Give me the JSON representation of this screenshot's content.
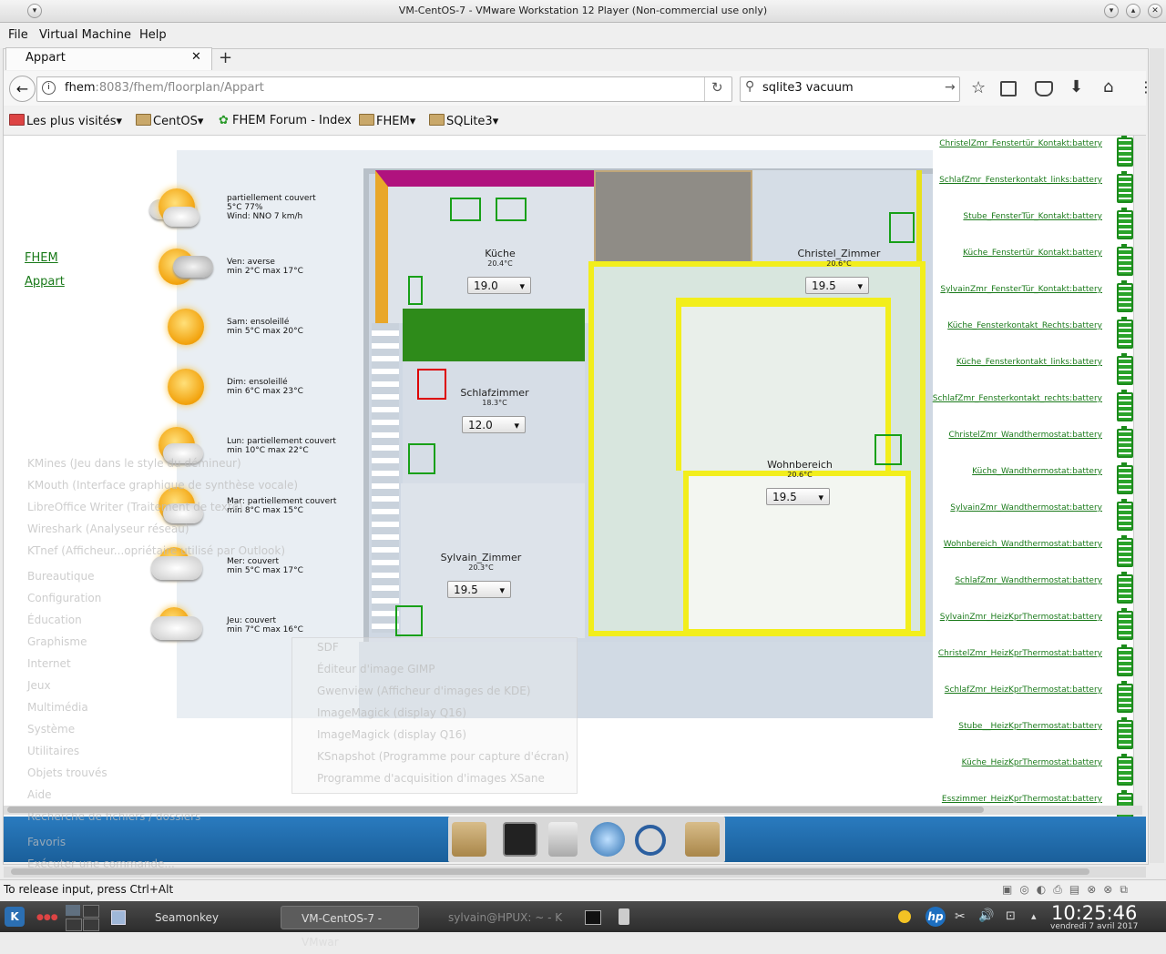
{
  "window": {
    "title": "VM-CentOS-7 - VMware Workstation 12 Player (Non-commercial use only)",
    "menu": [
      "File",
      "Virtual Machine",
      "Help"
    ]
  },
  "browser": {
    "tab_title": "Appart",
    "url_host": "fhem",
    "url_path": ":8083/fhem/floorplan/Appart",
    "search_value": "sqlite3 vacuum",
    "bookmarks": [
      "Les plus visités",
      "CentOS",
      "FHEM Forum - Index",
      "FHEM",
      "SQLite3"
    ]
  },
  "fhem": {
    "links": [
      "FHEM",
      "Appart"
    ],
    "weather": [
      {
        "line1": "partiellement couvert",
        "line2": "5°C 77%",
        "line3": "Wind: NNO 7 km/h",
        "icon": "partly-cloudy-icon"
      },
      {
        "line1": "Ven: averse",
        "line2": "min 2°C max 17°C",
        "icon": "rain-showers-icon"
      },
      {
        "line1": "Sam: ensoleillé",
        "line2": "min 5°C max 20°C",
        "icon": "sunny-icon"
      },
      {
        "line1": "Dim: ensoleillé",
        "line2": "min 6°C max 23°C",
        "icon": "sunny-icon"
      },
      {
        "line1": "Lun: partiellement couvert",
        "line2": "min 10°C max 22°C",
        "icon": "partly-cloudy-icon"
      },
      {
        "line1": "Mar: partiellement couvert",
        "line2": "min 8°C max 15°C",
        "icon": "partly-cloudy-icon"
      },
      {
        "line1": "Mer: couvert",
        "line2": "min 5°C max 17°C",
        "icon": "cloudy-icon"
      },
      {
        "line1": "Jeu: couvert",
        "line2": "min 7°C max 16°C",
        "icon": "cloudy-icon"
      }
    ],
    "rooms": [
      {
        "name": "Küche",
        "temp": "20.4°C",
        "setpoint": "19.0"
      },
      {
        "name": "Christel_Zimmer",
        "temp": "20.6°C",
        "setpoint": "19.5"
      },
      {
        "name": "Schlafzimmer",
        "temp": "18.3°C",
        "setpoint": "12.0"
      },
      {
        "name": "Wohnbereich",
        "temp": "20.6°C",
        "setpoint": "19.5"
      },
      {
        "name": "Sylvain_Zimmer",
        "temp": "20.3°C",
        "setpoint": "19.5"
      }
    ],
    "battery_links": [
      "ChristelZmr_Fenstertür_Kontakt:battery",
      "SchlafZmr_Fensterkontakt_links:battery",
      "Stube_FensterTür_Kontakt:battery",
      "Küche_Fenstertür_Kontakt:battery",
      "SylvainZmr_FensterTür_Kontakt:battery",
      "Küche_Fensterkontakt_Rechts:battery",
      "Küche_Fensterkontakt_links:battery",
      "SchlafZmr_Fensterkontakt_rechts:battery",
      "ChristelZmr_Wandthermostat:battery",
      "Küche_Wandthermostat:battery",
      "SylvainZmr_Wandthermostat:battery",
      "Wohnbereich_Wandthermostat:battery",
      "SchlafZmr_Wandthermostat:battery",
      "SylvainZmr_HeizKprThermostat:battery",
      "ChristelZmr_HeizKprThermostat:battery",
      "SchlafZmr_HeizKprThermostat:battery",
      "Stube__HeizKprThermostat:battery",
      "Küche_HeizKprThermostat:battery",
      "Esszimmer_HeizKprThermostat:battery"
    ]
  },
  "kde_menu": {
    "apps": [
      "KMines (Jeu dans le style du démineur)",
      "KMouth (Interface graphique de synthèse vocale)",
      "LibreOffice Writer (Traitement de texte)",
      "Wireshark (Analyseur réseau)",
      "KTnef (Afficheur...opriétaire utilisé par Outlook)"
    ],
    "categories": [
      "Bureautique",
      "Configuration",
      "Éducation",
      "Graphisme",
      "Internet",
      "Jeux",
      "Multimédia",
      "Système",
      "Utilitaires",
      "Objets trouvés",
      "Aide"
    ],
    "footer": [
      "Recherche de fichiers / dossiers",
      "Favoris",
      "Exécuter une commande..."
    ],
    "submenu": [
      "SDF",
      "Éditeur d'image GIMP",
      "Gwenview (Afficheur d'images de KDE)",
      "ImageMagick (display Q16)",
      "ImageMagick (display Q16)",
      "KSnapshot (Programme pour capture d'écran)",
      "Programme d'acquisition d'images XSane"
    ]
  },
  "status": {
    "release_text": "To release input, press Ctrl+Alt"
  },
  "taskbar": {
    "items": [
      "Seamonkey",
      "VM-CentOS-7 - VMwar",
      "sylvain@HPUX: ~ - K"
    ],
    "time": "10:25:46",
    "date": "vendredi 7 avril 2017"
  }
}
